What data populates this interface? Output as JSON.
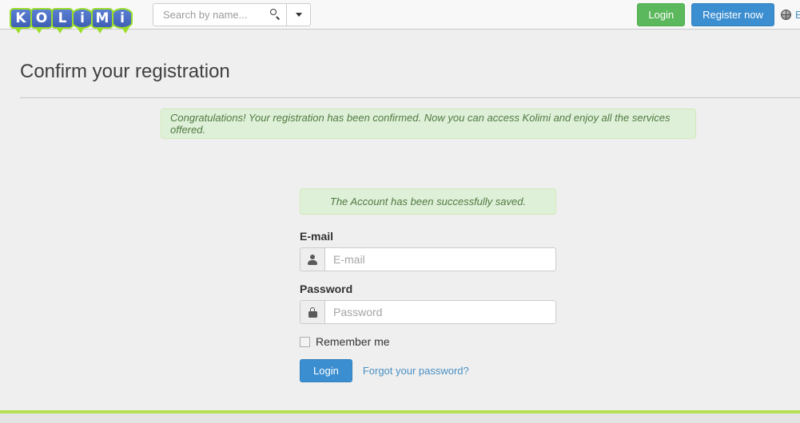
{
  "header": {
    "logo": {
      "name": "Kolimi",
      "letters": [
        "K",
        "O",
        "L",
        "i",
        "M",
        "i"
      ]
    },
    "search": {
      "placeholder": "Search by name...",
      "value": "",
      "icon": "search-icon",
      "dropdown_icon": "chevron-down-icon"
    },
    "login_label": "Login",
    "register_label": "Register now",
    "language": {
      "icon": "globe-icon",
      "label": "E"
    }
  },
  "page": {
    "title": "Confirm your registration"
  },
  "alerts": {
    "confirmation": "Congratulations! Your registration has been confirmed. Now you can access Kolimi and enjoy all the services offered.",
    "account_saved": "The Account has been successfully saved."
  },
  "login_form": {
    "email": {
      "label": "E-mail",
      "placeholder": "E-mail",
      "value": "",
      "icon": "user-icon"
    },
    "password": {
      "label": "Password",
      "placeholder": "Password",
      "value": "",
      "icon": "lock-icon"
    },
    "remember_me_label": "Remember me",
    "remember_me_checked": false,
    "submit_label": "Login",
    "forgot_label": "Forgot your password?"
  },
  "colors": {
    "brand_green": "#5cb85c",
    "brand_blue": "#3b8ed0",
    "alert_bg": "#dff0d8",
    "alert_border": "#d0e9b9",
    "alert_text": "#4f7a42",
    "footer_green": "#b6e052",
    "page_bg": "#efefef",
    "link_blue": "#4a90c4"
  }
}
